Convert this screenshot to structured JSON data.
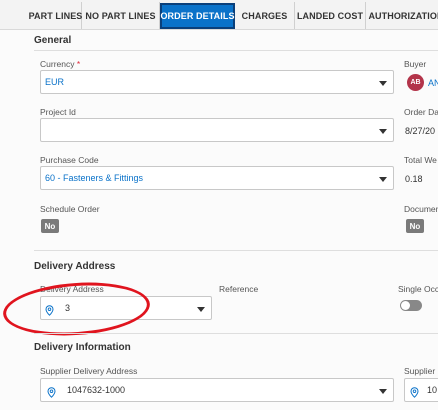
{
  "tabs": [
    "PART LINES",
    "NO PART LINES",
    "ORDER DETAILS",
    "CHARGES",
    "LANDED COST",
    "AUTHORIZATION"
  ],
  "general": {
    "title": "General",
    "currency_label": "Currency",
    "currency_required": "*",
    "currency_value": "EUR",
    "buyer_label": "Buyer",
    "buyer_initials": "AB",
    "buyer_name": "AN",
    "project_label": "Project Id",
    "project_value": "",
    "order_date_label": "Order Da",
    "order_date_value": "8/27/20",
    "purchase_code_label": "Purchase Code",
    "purchase_code_value": "60 - Fasteners & Fittings",
    "total_weight_label": "Total We",
    "total_weight_value": "0.18",
    "schedule_label": "Schedule Order",
    "schedule_value": "No",
    "document_label": "Documen",
    "document_value": "No"
  },
  "delivery_address": {
    "title": "Delivery Address",
    "address_label": "Delivery Address",
    "address_value": "3",
    "reference_label": "Reference",
    "single_label": "Single Occ"
  },
  "delivery_information": {
    "title": "Delivery Information",
    "supplier_address_label": "Supplier Delivery Address",
    "supplier_address_value": "1047632-1000",
    "supplier_label": "Supplier",
    "supplier_value": "10"
  },
  "colors": {
    "accent": "#0a72c9",
    "annotation": "#e0141e",
    "avatar": "#b3344a"
  }
}
